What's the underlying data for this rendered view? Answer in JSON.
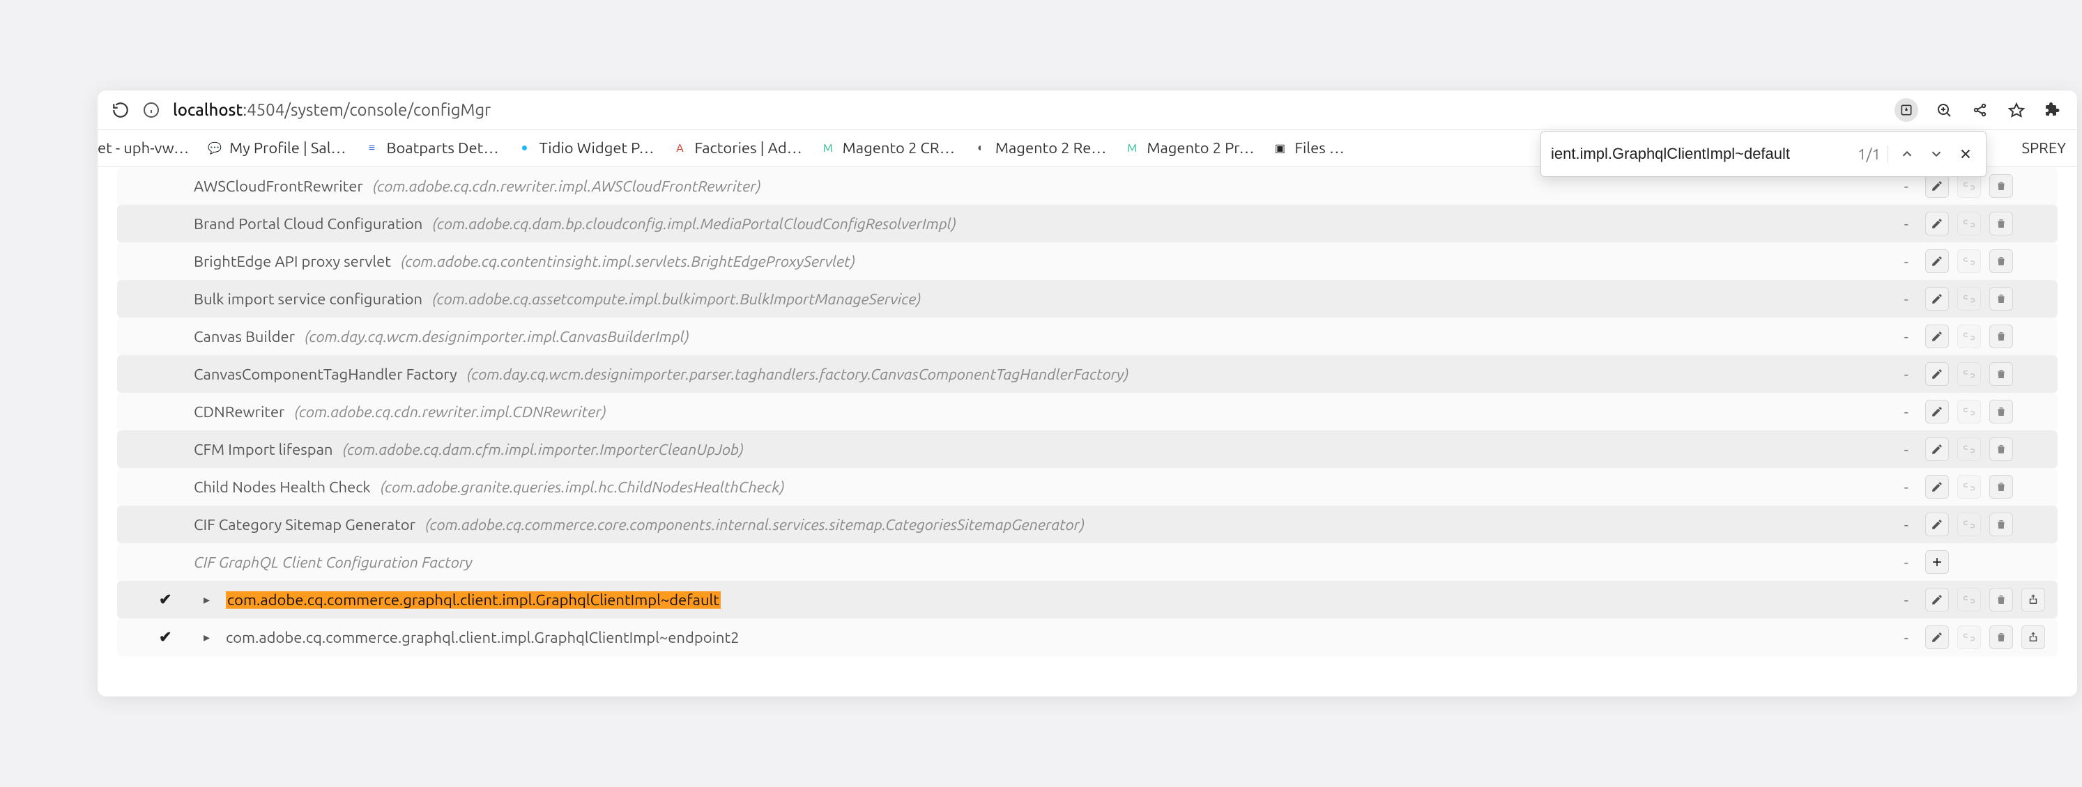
{
  "address": {
    "host": "localhost",
    "rest": ":4504/system/console/configMgr"
  },
  "find": {
    "query": "ient.impl.GraphqlClientImpl~default",
    "count": "1/1"
  },
  "bookmarks": {
    "left_trunc": "et - uph-vw…",
    "items": [
      {
        "label": "My Profile | Sal…",
        "color": "#0b89ff",
        "glyph": "💬"
      },
      {
        "label": "Boatparts Det…",
        "color": "#3b6fe0",
        "glyph": "≡"
      },
      {
        "label": "Tidio Widget P…",
        "color": "#17b8ff",
        "glyph": "●"
      },
      {
        "label": "Factories | Ad…",
        "color": "#d6321f",
        "glyph": "A"
      },
      {
        "label": "Magento 2 CR…",
        "color": "#22c08a",
        "glyph": "M"
      },
      {
        "label": "Magento 2 Re…",
        "color": "#555555",
        "glyph": "◐"
      },
      {
        "label": "Magento 2 Pr…",
        "color": "#22c08a",
        "glyph": "M"
      },
      {
        "label": "Files …",
        "color": "#222222",
        "glyph": "▣"
      }
    ],
    "right_trunc": "SPREY"
  },
  "rows": [
    {
      "type": "normal",
      "title": "AWSCloudFrontRewriter",
      "pid": "(com.adobe.cq.cdn.rewriter.impl.AWSCloudFrontRewriter)",
      "actions": [
        "edit",
        "unbind",
        "delete"
      ],
      "bg": "odd"
    },
    {
      "type": "normal",
      "title": "Brand Portal Cloud Configuration",
      "pid": "(com.adobe.cq.dam.bp.cloudconfig.impl.MediaPortalCloudConfigResolverImpl)",
      "actions": [
        "edit",
        "unbind",
        "delete"
      ],
      "bg": "even"
    },
    {
      "type": "normal",
      "title": "BrightEdge API proxy servlet",
      "pid": "(com.adobe.cq.contentinsight.impl.servlets.BrightEdgeProxyServlet)",
      "actions": [
        "edit",
        "unbind",
        "delete"
      ],
      "bg": "odd"
    },
    {
      "type": "normal",
      "title": "Bulk import service configuration",
      "pid": "(com.adobe.cq.assetcompute.impl.bulkimport.BulkImportManageService)",
      "actions": [
        "edit",
        "unbind",
        "delete"
      ],
      "bg": "even"
    },
    {
      "type": "normal",
      "title": "Canvas Builder",
      "pid": "(com.day.cq.wcm.designimporter.impl.CanvasBuilderImpl)",
      "actions": [
        "edit",
        "unbind",
        "delete"
      ],
      "bg": "odd"
    },
    {
      "type": "normal",
      "title": "CanvasComponentTagHandler Factory",
      "pid": "(com.day.cq.wcm.designimporter.parser.taghandlers.factory.CanvasComponentTagHandlerFactory)",
      "actions": [
        "edit",
        "unbind",
        "delete"
      ],
      "bg": "even"
    },
    {
      "type": "normal",
      "title": "CDNRewriter",
      "pid": "(com.adobe.cq.cdn.rewriter.impl.CDNRewriter)",
      "actions": [
        "edit",
        "unbind",
        "delete"
      ],
      "bg": "odd"
    },
    {
      "type": "normal",
      "title": "CFM Import lifespan",
      "pid": "(com.adobe.cq.dam.cfm.impl.importer.ImporterCleanUpJob)",
      "actions": [
        "edit",
        "unbind",
        "delete"
      ],
      "bg": "even"
    },
    {
      "type": "normal",
      "title": "Child Nodes Health Check",
      "pid": "(com.adobe.granite.queries.impl.hc.ChildNodesHealthCheck)",
      "actions": [
        "edit",
        "unbind",
        "delete"
      ],
      "bg": "odd"
    },
    {
      "type": "normal",
      "title": "CIF Category Sitemap Generator",
      "pid": "(com.adobe.cq.commerce.core.components.internal.services.sitemap.CategoriesSitemapGenerator)",
      "actions": [
        "edit",
        "unbind",
        "delete"
      ],
      "bg": "even"
    },
    {
      "type": "factory",
      "title": "CIF GraphQL Client Configuration Factory",
      "actions": [
        "add"
      ],
      "bg": "odd"
    },
    {
      "type": "instance",
      "checked": true,
      "highlight": true,
      "title": "com.adobe.cq.commerce.graphql.client.impl.GraphqlClientImpl~default",
      "actions": [
        "edit",
        "unbind",
        "delete",
        "copy"
      ],
      "bg": "even"
    },
    {
      "type": "instance",
      "checked": true,
      "highlight": false,
      "title": "com.adobe.cq.commerce.graphql.client.impl.GraphqlClientImpl~endpoint2",
      "actions": [
        "edit",
        "unbind",
        "delete",
        "copy"
      ],
      "bg": "odd"
    }
  ],
  "dash": "-"
}
